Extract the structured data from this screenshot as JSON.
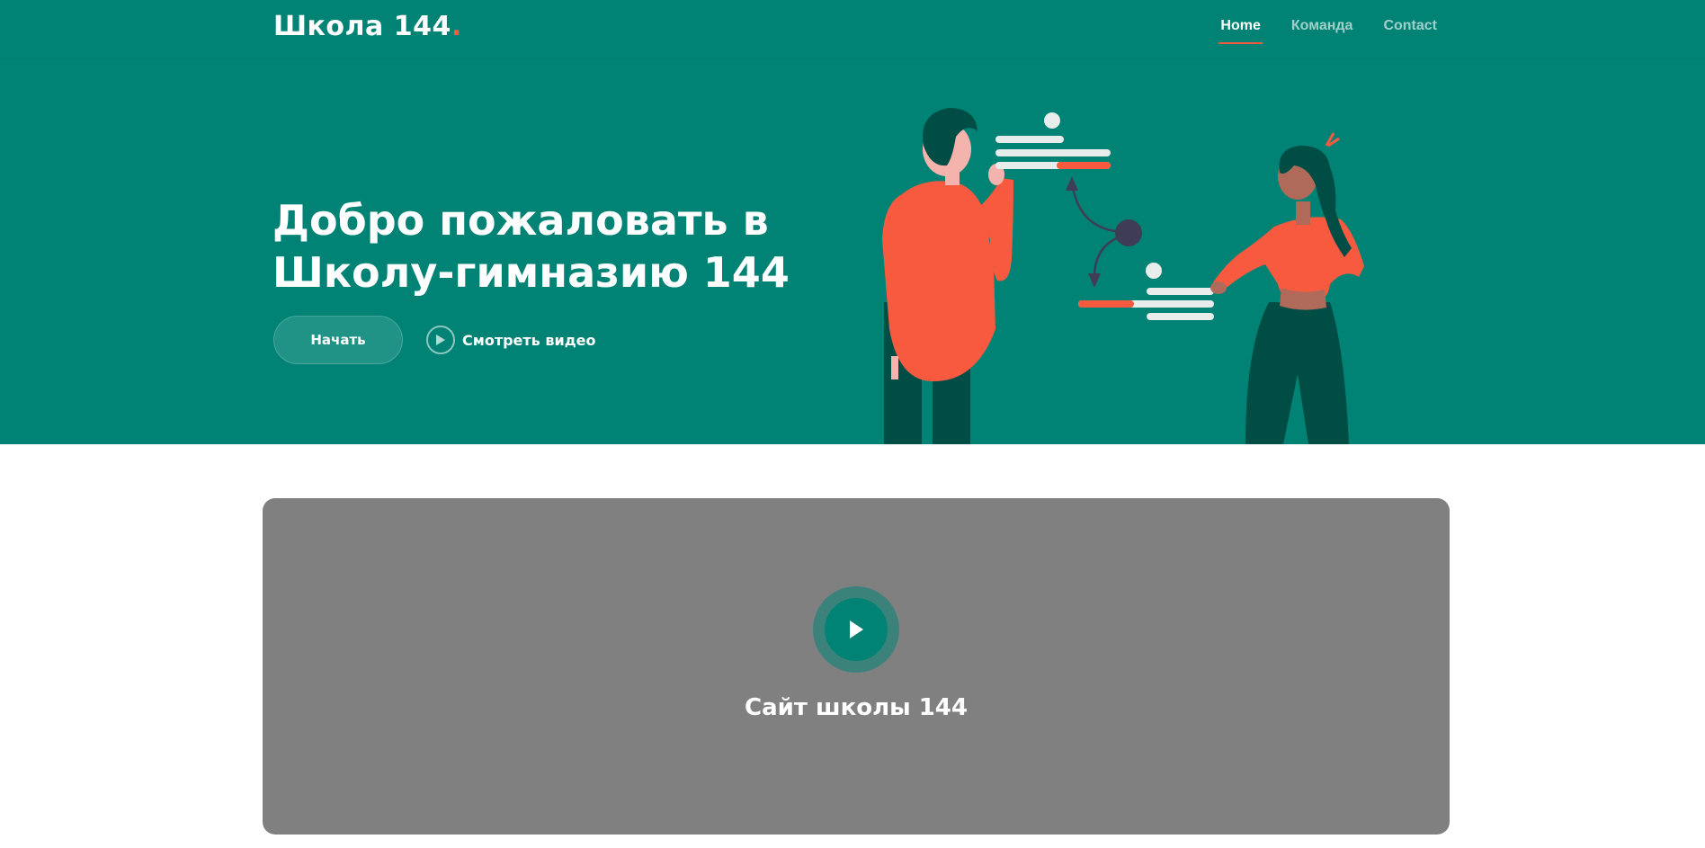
{
  "header": {
    "logo_text": "Школа 144",
    "logo_dot": ".",
    "nav": [
      {
        "label": "Home"
      },
      {
        "label": "Команда"
      },
      {
        "label": "Contact"
      }
    ]
  },
  "hero": {
    "title_line1": "Добро пожаловать в",
    "title_line2": "Школу-гимназию 144",
    "start_button": "Начать",
    "watch_video": "Смотреть видео"
  },
  "video": {
    "title": "Сайт школы 144"
  },
  "colors": {
    "primary": "#008374",
    "accent": "#f85a40",
    "dark_green": "#004d45",
    "card_gray": "#808080"
  },
  "icons": {
    "watch": "play-circle-icon",
    "video": "play-icon"
  }
}
